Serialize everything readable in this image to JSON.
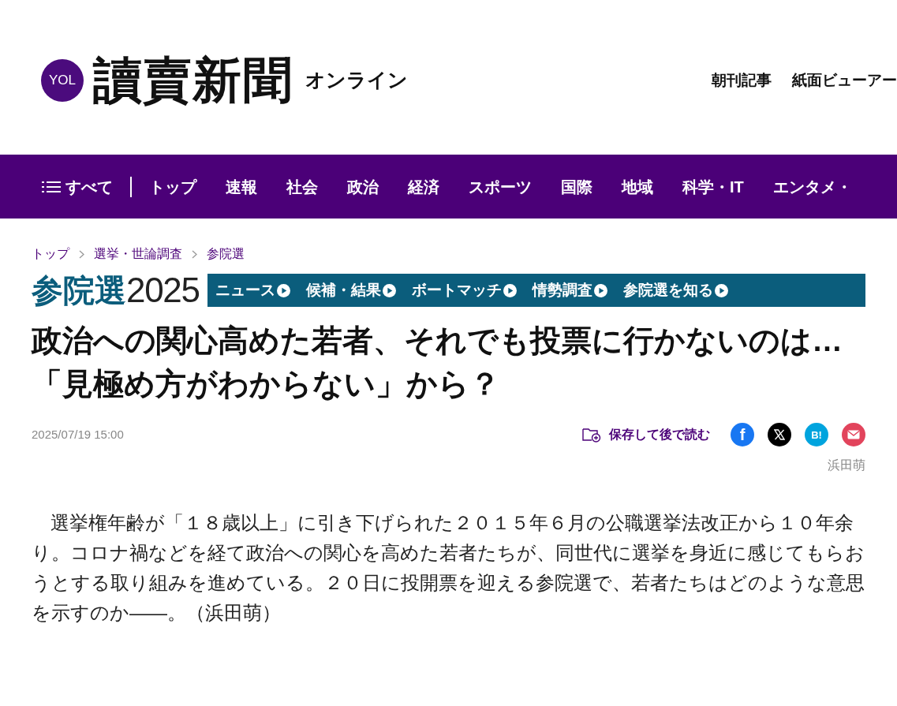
{
  "header": {
    "logo_badge": "YOL",
    "logo_title": "讀賣新聞",
    "logo_suffix": "オンライン",
    "links": [
      "朝刊記事",
      "紙面ビューアー"
    ]
  },
  "nav": {
    "menu_label": "すべて",
    "items": [
      "トップ",
      "速報",
      "社会",
      "政治",
      "経済",
      "スポーツ",
      "国際",
      "地域",
      "科学・IT",
      "エンタメ・"
    ]
  },
  "breadcrumb": [
    "トップ",
    "選挙・世論調査",
    "参院選"
  ],
  "election_banner": {
    "title": "参院選",
    "year": "2025",
    "links": [
      "ニュース",
      "候補・結果",
      "ボートマッチ",
      "情勢調査",
      "参院選を知る"
    ]
  },
  "article": {
    "headline_lines": [
      "政治への関心高めた若者、それでも投票に行かないのは…",
      "「見極め方がわからない」から？"
    ],
    "date": "2025/07/19 15:00",
    "save_label": "保存して後で読む",
    "share": [
      {
        "kind": "facebook",
        "text": "f"
      },
      {
        "kind": "x"
      },
      {
        "kind": "hatena",
        "text": "B!"
      },
      {
        "kind": "mail"
      }
    ],
    "author": "浜田萌",
    "body": "　選挙権年齢が「１８歳以上」に引き下げられた２０１５年６月の公職選挙法改正から１０年余り。コロナ禍などを経て政治への関心を高めた若者たちが、同世代に選挙を身近に感じてもらおうとする取り組みを進めている。２０日に投開票を迎える参院選で、若者たちはどのような意思を示すのか――。（浜田萌）"
  }
}
